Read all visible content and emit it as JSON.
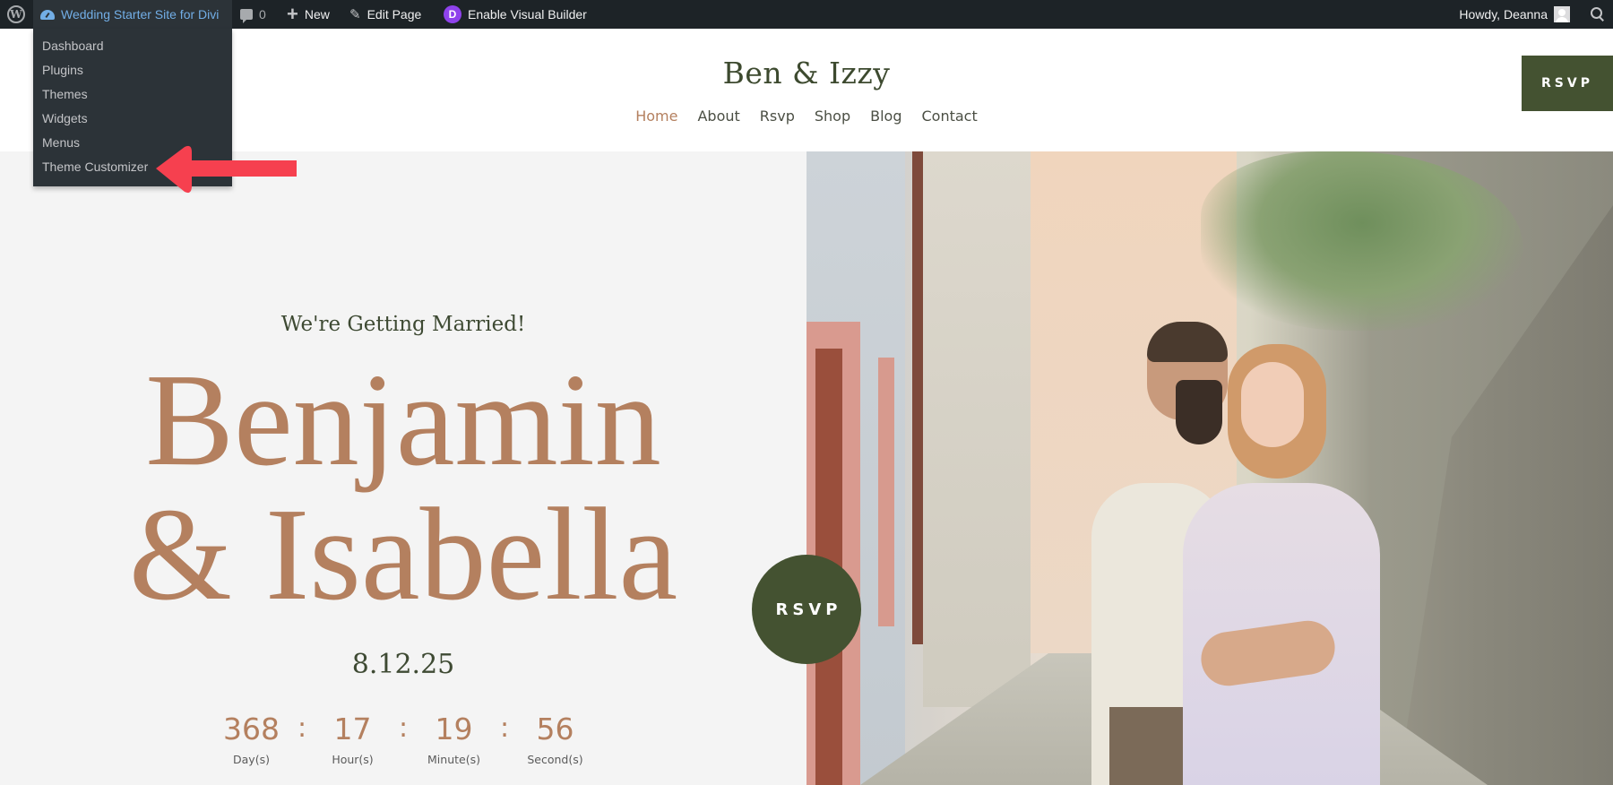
{
  "admin_bar": {
    "wp_logo_icon": "wordpress-logo-icon",
    "site_name": "Wedding Starter Site for Divi",
    "site_icon": "dashboard-gauge-icon",
    "comments_count": "0",
    "new_label": "New",
    "edit_label": "Edit Page",
    "divi_badge": "D",
    "visual_builder_label": "Enable Visual Builder",
    "howdy": "Howdy, Deanna",
    "search_icon": "search-icon"
  },
  "site_dropdown": {
    "items": [
      {
        "label": "Dashboard"
      },
      {
        "label": "Plugins"
      },
      {
        "label": "Themes"
      },
      {
        "label": "Widgets"
      },
      {
        "label": "Menus"
      },
      {
        "label": "Theme Customizer"
      }
    ],
    "highlighted_item": "Theme Customizer",
    "annotation_color": "#f6404f"
  },
  "header": {
    "site_title": "Ben & Izzy",
    "nav": [
      {
        "label": "Home",
        "active": true
      },
      {
        "label": "About"
      },
      {
        "label": "Rsvp"
      },
      {
        "label": "Shop"
      },
      {
        "label": "Blog"
      },
      {
        "label": "Contact"
      }
    ],
    "rsvp_button": "RSVP"
  },
  "hero": {
    "tagline": "We're Getting Married!",
    "headline_line1": "Benjamin",
    "headline_line2": "& Isabella",
    "date": "8.12.25",
    "rsvp_circle": "RSVP",
    "countdown": [
      {
        "value": "368",
        "label": "Day(s)"
      },
      {
        "value": "17",
        "label": "Hour(s)"
      },
      {
        "value": "19",
        "label": "Minute(s)"
      },
      {
        "value": "56",
        "label": "Second(s)"
      }
    ],
    "separator": ":",
    "photo_alt": "Couple embracing in a cobblestone alley"
  },
  "colors": {
    "accent_terracotta": "#b4805f",
    "brand_green": "#445231",
    "admin_bar_bg": "#1d2327",
    "admin_link_blue": "#72aee6"
  }
}
